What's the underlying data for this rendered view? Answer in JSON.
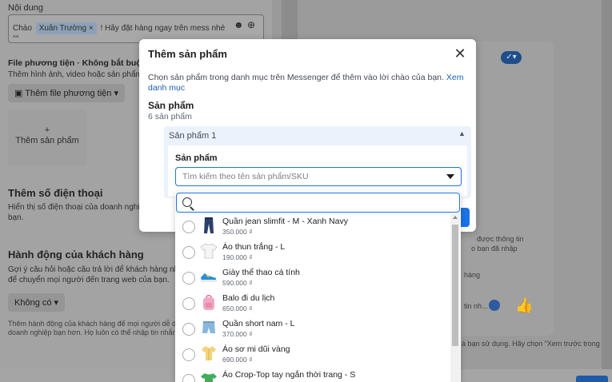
{
  "background": {
    "content_label": "Nội dung",
    "greeting": {
      "prefix": "Chào",
      "tag": "Xuân Trường",
      "tag_close": "×",
      "suffix": "! Hãy đặt hàng ngay trên mess nhé",
      "extra": "^^"
    },
    "media_label": "File phương tiện · Không bắt buộc",
    "media_desc": "Thêm hình ảnh, video hoặc sản phẩm",
    "add_media_button": "Thêm file phương tiện",
    "add_product_box": "Thêm sản phẩm",
    "phone_title": "Thêm số điện thoại",
    "phone_desc_1": "Hiển thị số điện thoại của doanh nghi",
    "phone_desc_2": "bạn.",
    "action_title": "Hành động của khách hàng",
    "action_desc_1": "Gợi ý câu hỏi hoặc câu trả lời để khách hàng nhấ",
    "action_desc_2": "để chuyển mọi người đến trang web của bạn.",
    "action_select": "Không có",
    "action_note_1": "Thêm hành động của khách hàng để mọi người dễ dàng",
    "action_note_2": "doanh nghiệp bạn hơn. Họ luôn có thể nhập tin nhắn riê",
    "preview_info_1": "được thông tin",
    "preview_info_2": "o bạn đã nhập",
    "preview_bubble": "hàng",
    "preview_input": "tin nh...",
    "preview_footer": "à bạn sử dụng. Hãy chọn \"Xem trước trong"
  },
  "modal": {
    "title": "Thêm sản phẩm",
    "description": "Chọn sản phẩm trong danh mục trên Messenger để thêm vào lời chào của bạn.",
    "description_link_1": "Xem danh",
    "description_link_2": "mục",
    "section_title": "Sản phẩm",
    "section_count": "6 sản phẩm",
    "panel_header": "Sản phẩm 1",
    "field_label": "Sản phẩm",
    "select_placeholder": "Tìm kiếm theo tên sản phẩm/SKU"
  },
  "dropdown": {
    "search_value": "",
    "items": [
      {
        "name": "Quần jean slimfit - M - Xanh Navy",
        "price": "350.000 ₫",
        "icon": "jeans-icon"
      },
      {
        "name": "Áo thun trắng - L",
        "price": "190.000 ₫",
        "icon": "tshirt-icon"
      },
      {
        "name": "Giày thể thao cá tính",
        "price": "590.000 ₫",
        "icon": "sneaker-icon"
      },
      {
        "name": "Balo đi du lịch",
        "price": "650.000 ₫",
        "icon": "backpack-icon"
      },
      {
        "name": "Quần short nam - L",
        "price": "370.000 ₫",
        "icon": "shorts-icon"
      },
      {
        "name": "Áo sơ mi dũi vàng",
        "price": "690.000 ₫",
        "icon": "shirt-icon"
      },
      {
        "name": "Áo Crop-Top tay ngắn thời trang - S",
        "price": "",
        "icon": "croptop-icon"
      }
    ]
  },
  "colors": {
    "accent": "#1a73e8",
    "panel": "#ebf2fc"
  }
}
